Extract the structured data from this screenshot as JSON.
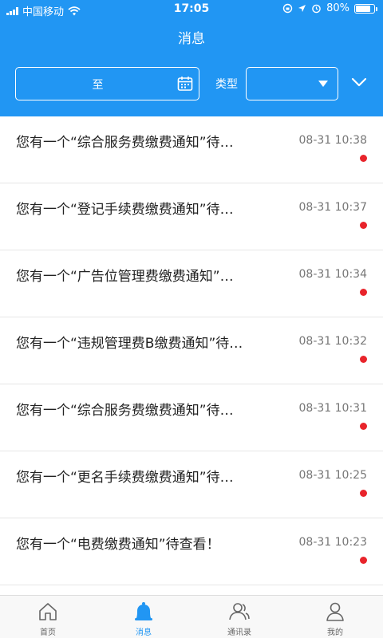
{
  "status_bar": {
    "carrier": "中国移动",
    "time": "17:05",
    "battery": "80%",
    "battery_level": 0.8
  },
  "header": {
    "title": "消息"
  },
  "filter": {
    "date_separator": "至",
    "type_label": "类型",
    "type_value": ""
  },
  "messages": [
    {
      "text": "您有一个“综合服务费缴费通知”待…",
      "time": "08-31 10:38",
      "unread": true
    },
    {
      "text": "您有一个“登记手续费缴费通知”待…",
      "time": "08-31 10:37",
      "unread": true
    },
    {
      "text": "您有一个“广告位管理费缴费通知”…",
      "time": "08-31 10:34",
      "unread": true
    },
    {
      "text": "您有一个“违规管理费B缴费通知”待…",
      "time": "08-31 10:32",
      "unread": true
    },
    {
      "text": "您有一个“综合服务费缴费通知”待…",
      "time": "08-31 10:31",
      "unread": true
    },
    {
      "text": "您有一个“更名手续费缴费通知”待…",
      "time": "08-31 10:25",
      "unread": true
    },
    {
      "text": "您有一个“电费缴费通知”待查看！",
      "time": "08-31 10:23",
      "unread": true
    }
  ],
  "tabs": [
    {
      "label": "首页",
      "icon": "home-icon",
      "active": false
    },
    {
      "label": "消息",
      "icon": "bell-icon",
      "active": true
    },
    {
      "label": "通讯录",
      "icon": "contacts-icon",
      "active": false
    },
    {
      "label": "我的",
      "icon": "user-icon",
      "active": false
    }
  ],
  "colors": {
    "primary": "#2196f3",
    "unread_dot": "#e8242b"
  }
}
